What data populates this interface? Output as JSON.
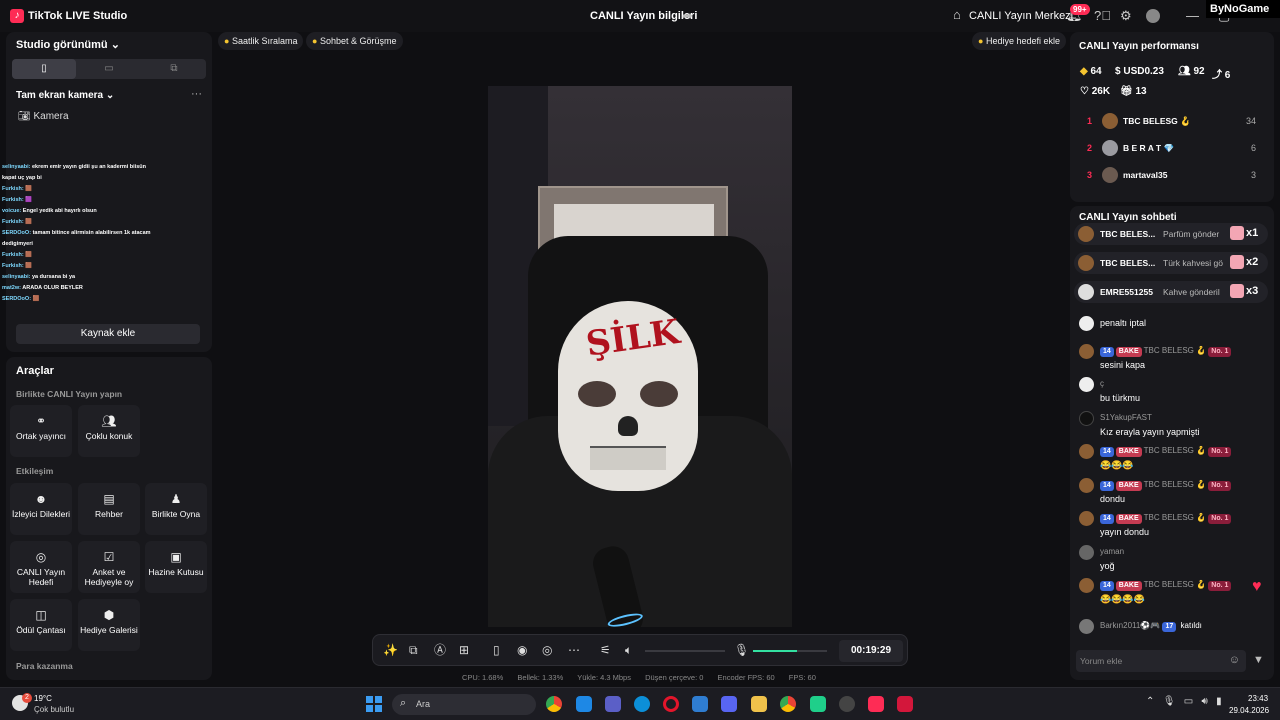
{
  "titlebar": {
    "app_title": "TikTok LIVE Studio",
    "live_info": "CANLI Yayın bilgileri",
    "center_link": "CANLI Yayın Merkezi",
    "notif_count": "99+",
    "watermark": "ByNoGame"
  },
  "left": {
    "studio_view": "Studio görünümü",
    "camera_title": "Tam ekran kamera",
    "camera_item": "Kamera",
    "add_source": "Kaynak ekle",
    "overlay_chat": [
      {
        "user": "selinyaabi:",
        "text": "ekrem emir yayın gidii şu an kadermi biisün"
      },
      {
        "user": "",
        "text": "kapat uç yap bi"
      },
      {
        "user": "Furkish:",
        "text": "🟫"
      },
      {
        "user": "Furkish:",
        "text": "🟪"
      },
      {
        "user": "voicue:",
        "text": "Engel yedik abi hayırlı olsun"
      },
      {
        "user": "Furkish:",
        "text": "🟫"
      },
      {
        "user": "SERDOoO:",
        "text": "tamam bitince alirmisin alabilirsen 1k atacam"
      },
      {
        "user": "",
        "text": "dedigimyeri"
      },
      {
        "user": "Furkish:",
        "text": "🟫"
      },
      {
        "user": "Furkish:",
        "text": "🟫"
      },
      {
        "user": "selinyaabi:",
        "text": "ya dursana bi ya"
      },
      {
        "user": "mat2w:",
        "text": "ARADA OLUR BEYLER"
      },
      {
        "user": "SERDOoO:",
        "text": "🟫"
      }
    ],
    "tools_title": "Araçlar",
    "section_together": "Birlikte CANLI Yayın yapın",
    "section_interaction": "Etkileşim",
    "section_earn": "Para kazanma",
    "tools_together": [
      {
        "label": "Ortak yayıncı",
        "icon": "link-icon"
      },
      {
        "label": "Çoklu konuk",
        "icon": "users-icon"
      }
    ],
    "tools_interaction": [
      {
        "label": "İzleyici Dilekleri",
        "icon": "viewer-icon"
      },
      {
        "label": "Rehber",
        "icon": "guide-icon"
      },
      {
        "label": "Birlikte Oyna",
        "icon": "play-together-icon"
      },
      {
        "label": "CANLI Yayın Hedefi",
        "icon": "target-icon"
      },
      {
        "label": "Anket ve Hediyeyle oy",
        "icon": "poll-icon"
      },
      {
        "label": "Hazine Kutusu",
        "icon": "treasure-icon"
      },
      {
        "label": "Ödül Çantası",
        "icon": "bag-icon"
      },
      {
        "label": "Hediye Galerisi",
        "icon": "gallery-icon"
      }
    ]
  },
  "chips": {
    "hourly_rank": "Saatlik Sıralama",
    "chat_meet": "Sohbet & Görüşme",
    "gift_goal": "Hediye hedefi ekle"
  },
  "video": {
    "mask_text": "ŞİLK"
  },
  "controls": {
    "timer": "00:19:29",
    "mic_level": 0.6
  },
  "stats": {
    "cpu": "CPU: 1.68%",
    "memory": "Bellek: 1.33%",
    "upload": "Yükle: 4.3 Mbps",
    "dropped": "Düşen çerçeve: 0",
    "encoder_fps": "Encoder FPS: 60",
    "fps": "FPS: 60"
  },
  "performance": {
    "title": "CANLI Yayın performansı",
    "diamonds": "64",
    "usd": "USD0.23",
    "viewers": "92",
    "shares": "6",
    "likes": "26K",
    "gifts": "13",
    "ranking": [
      {
        "rank": "1",
        "name": "TBC BELESG 🪝",
        "score": "34"
      },
      {
        "rank": "2",
        "name": "B E R A T 💎",
        "score": "6"
      },
      {
        "rank": "3",
        "name": "martaval35",
        "score": "3"
      }
    ]
  },
  "chat": {
    "title": "CANLI Yayın sohbeti",
    "gifts": [
      {
        "name": "TBC BELES...",
        "text": "Parfüm gönder",
        "count": "x1"
      },
      {
        "name": "TBC BELES...",
        "text": "Türk kahvesi gö",
        "count": "x2"
      },
      {
        "name": "EMRE551255",
        "text": "Kahve gönderil",
        "count": "x3"
      }
    ],
    "messages": [
      {
        "head": "",
        "text": "penaltı iptal"
      },
      {
        "head": "TBC BELESG 🪝",
        "text": "sesini kapa",
        "level": "14",
        "fan": "BAKE",
        "no1": "No. 1"
      },
      {
        "head": "ç",
        "text": "bu türkmu"
      },
      {
        "head": "S1YakupFAST",
        "text": "Kız erayla yayın yapmişti"
      },
      {
        "head": "TBC BELESG 🪝",
        "text": "😂😂😂",
        "level": "14",
        "fan": "BAKE",
        "no1": "No. 1"
      },
      {
        "head": "TBC BELESG 🪝",
        "text": "dondu",
        "level": "14",
        "fan": "BAKE",
        "no1": "No. 1"
      },
      {
        "head": "TBC BELESG 🪝",
        "text": "yayın dondu",
        "level": "14",
        "fan": "BAKE",
        "no1": "No. 1"
      },
      {
        "head": "yaman",
        "text": "yoğ"
      },
      {
        "head": "TBC BELESG 🪝",
        "text": "😂😂😂😂",
        "level": "14",
        "fan": "BAKE",
        "no1": "No. 1"
      }
    ],
    "join": {
      "user": "Barkın2011⚽🎮",
      "level": "17",
      "text": "katıldı"
    },
    "comment_placeholder": "Yorum ekle"
  },
  "taskbar": {
    "weather_badge": "2",
    "temp": "19°C",
    "weather": "Çok bulutlu",
    "search_placeholder": "Ara",
    "time": "23:43",
    "date": "29.04.2026"
  }
}
